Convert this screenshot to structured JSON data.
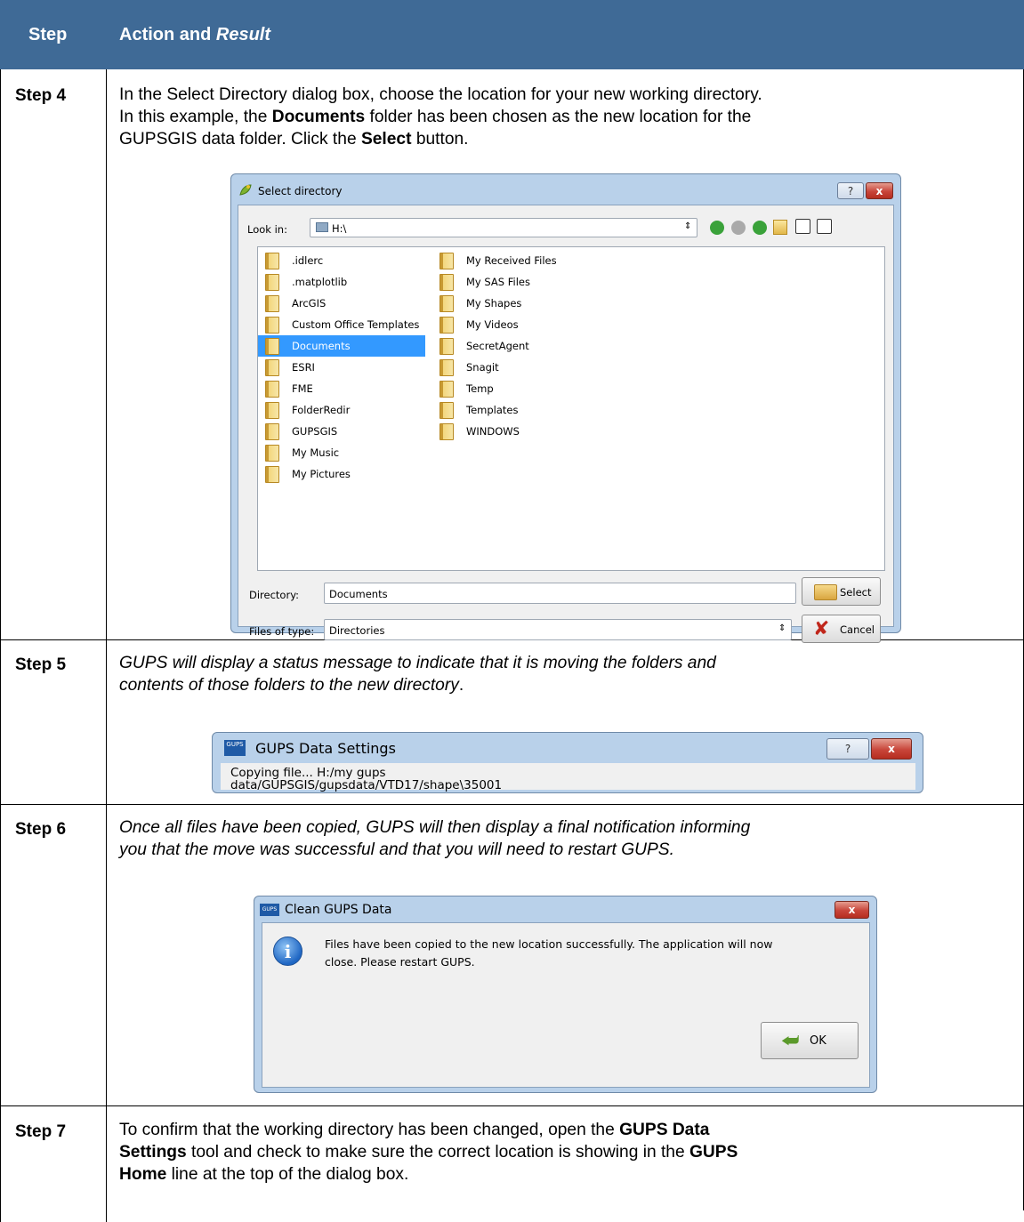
{
  "header": {
    "col1": "Step",
    "col2_prefix": "Action and ",
    "col2_italic": "Result"
  },
  "colors": {
    "header_bg": "#3f6a96",
    "selection": "#3399ff"
  },
  "steps": {
    "s4": {
      "label": "Step 4",
      "l1": "In the Select Directory dialog box, choose the location for your new working directory.",
      "l2a": "In this example, the ",
      "l2b": "Documents",
      "l2c": " folder has been chosen as the new location for the",
      "l3a": "GUPSGIS data folder. Click the ",
      "l3b": "Select",
      "l3c": " button."
    },
    "s5": {
      "label": "Step 5",
      "l1": "GUPS will display a status message to indicate that it is moving the folders and",
      "l2a": "contents of those folders to the new directory",
      "l2b": "."
    },
    "s6": {
      "label": "Step 6",
      "l1": "Once all files have been copied, GUPS will then display a final notification informing",
      "l2": "you that the move was successful and that you will need to restart GUPS."
    },
    "s7": {
      "label": "Step 7",
      "l1a": "To confirm that the working directory has been changed, open the ",
      "l1b": "GUPS Data",
      "l2a": "Settings",
      "l2b": " tool and check to make sure the correct location is showing in the ",
      "l2c": "GUPS",
      "l3a": "Home",
      "l3b": " line at the top of the dialog box."
    }
  },
  "select_dialog": {
    "title": "Select directory",
    "help": "?",
    "close": "x",
    "look_in_label": "Look in:",
    "look_in_value": "H:\\",
    "col1": [
      ".idlerc",
      ".matplotlib",
      "ArcGIS",
      "Custom Office Templates",
      "Documents",
      "ESRI",
      "FME",
      "FolderRedir",
      "GUPSGIS",
      "My Music",
      "My Pictures"
    ],
    "col2": [
      "My Received Files",
      "My SAS Files",
      "My Shapes",
      "My Videos",
      "SecretAgent",
      "Snagit",
      "Temp",
      "Templates",
      "WINDOWS"
    ],
    "selected": "Documents",
    "directory_label": "Directory:",
    "directory_value": "Documents",
    "files_type_label": "Files of type:",
    "files_type_value": "Directories",
    "select_btn": "Select",
    "cancel_btn": "Cancel"
  },
  "settings_dialog": {
    "title": "GUPS Data Settings",
    "help": "?",
    "close": "x",
    "msg1": "Copying file... H:/my gups",
    "msg2": "data/GUPSGIS/gupsdata/VTD17/shape\\35001"
  },
  "clean_dialog": {
    "title": "Clean GUPS Data",
    "close": "x",
    "msg1": "Files have been copied to the new location successfully. The application will now",
    "msg2": "close. Please restart GUPS.",
    "ok": "OK"
  },
  "icons": {
    "app": "GUPS",
    "info": "i"
  }
}
